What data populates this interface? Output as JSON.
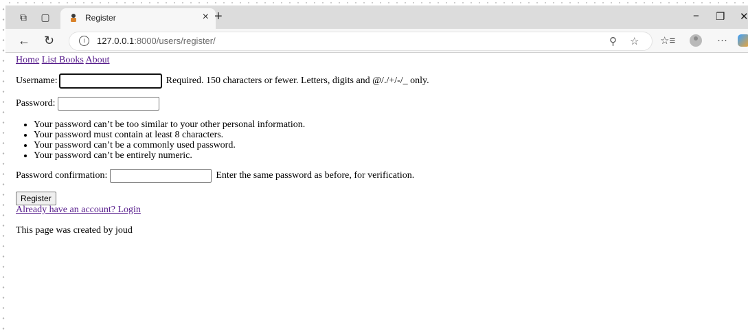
{
  "browser": {
    "tab_title": "Register",
    "url_host": "127.0.0.1",
    "url_path": ":8000/users/register/"
  },
  "nav": {
    "home": "Home",
    "list_books": "List Books",
    "about": "About"
  },
  "form": {
    "username_label": "Username:",
    "username_value": "",
    "username_help": "Required. 150 characters or fewer. Letters, digits and @/./+/-/_ only.",
    "password_label": "Password:",
    "password_value": "",
    "password_help": [
      "Your password can’t be too similar to your other personal information.",
      "Your password must contain at least 8 characters.",
      "Your password can’t be a commonly used password.",
      "Your password can’t be entirely numeric."
    ],
    "confirm_label": "Password confirmation:",
    "confirm_value": "",
    "confirm_help": "Enter the same password as before, for verification.",
    "submit_label": "Register"
  },
  "login_link": "Already have an account? Login",
  "footer": "This page was created by joud"
}
